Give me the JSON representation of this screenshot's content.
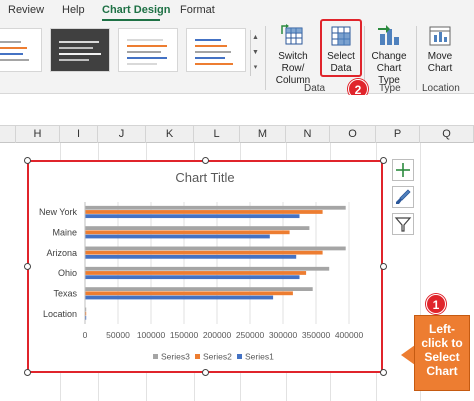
{
  "menu": {
    "items": [
      {
        "label": "Review",
        "active": false
      },
      {
        "label": "Help",
        "active": false
      },
      {
        "label": "Chart Design",
        "active": true
      },
      {
        "label": "Format",
        "active": false
      }
    ]
  },
  "ribbon": {
    "buttons": {
      "switch_row_column": {
        "line1": "Switch Row/",
        "line2": "Column",
        "icon": "switch-row-column-icon"
      },
      "select_data": {
        "line1": "Select",
        "line2": "Data",
        "icon": "select-data-icon"
      },
      "change_chart_type": {
        "line1": "Change",
        "line2": "Chart Type",
        "icon": "change-chart-type-icon"
      },
      "move_chart": {
        "line1": "Move",
        "line2": "Chart",
        "icon": "move-chart-icon"
      }
    },
    "groups": {
      "data": "Data",
      "type": "Type",
      "location": "Location"
    }
  },
  "badges": {
    "step1": "1",
    "step2": "2"
  },
  "columns": [
    "H",
    "I",
    "J",
    "K",
    "L",
    "M",
    "N",
    "O",
    "P",
    "Q"
  ],
  "chart_data": {
    "type": "bar",
    "orientation": "horizontal",
    "title": "Chart Title",
    "categories": [
      "New York",
      "Maine",
      "Arizona",
      "Ohio",
      "Texas",
      "Location"
    ],
    "series": [
      {
        "name": "Series1",
        "color": "#4472c4",
        "values": [
          325000,
          280000,
          320000,
          325000,
          285000,
          0
        ]
      },
      {
        "name": "Series2",
        "color": "#ed7d31",
        "values": [
          360000,
          310000,
          360000,
          335000,
          315000,
          0
        ]
      },
      {
        "name": "Series3",
        "color": "#a5a5a5",
        "values": [
          395000,
          340000,
          395000,
          370000,
          345000,
          0
        ]
      }
    ],
    "xlim": [
      0,
      400000
    ],
    "xticks": [
      "0",
      "50000",
      "100000",
      "150000",
      "200000",
      "250000",
      "300000",
      "350000",
      "400000"
    ],
    "legend": [
      "Series3",
      "Series2",
      "Series1"
    ],
    "legend_position": "bottom",
    "grid": true
  },
  "callout": {
    "lines": [
      "Left-",
      "click to",
      "Select",
      "Chart"
    ]
  }
}
